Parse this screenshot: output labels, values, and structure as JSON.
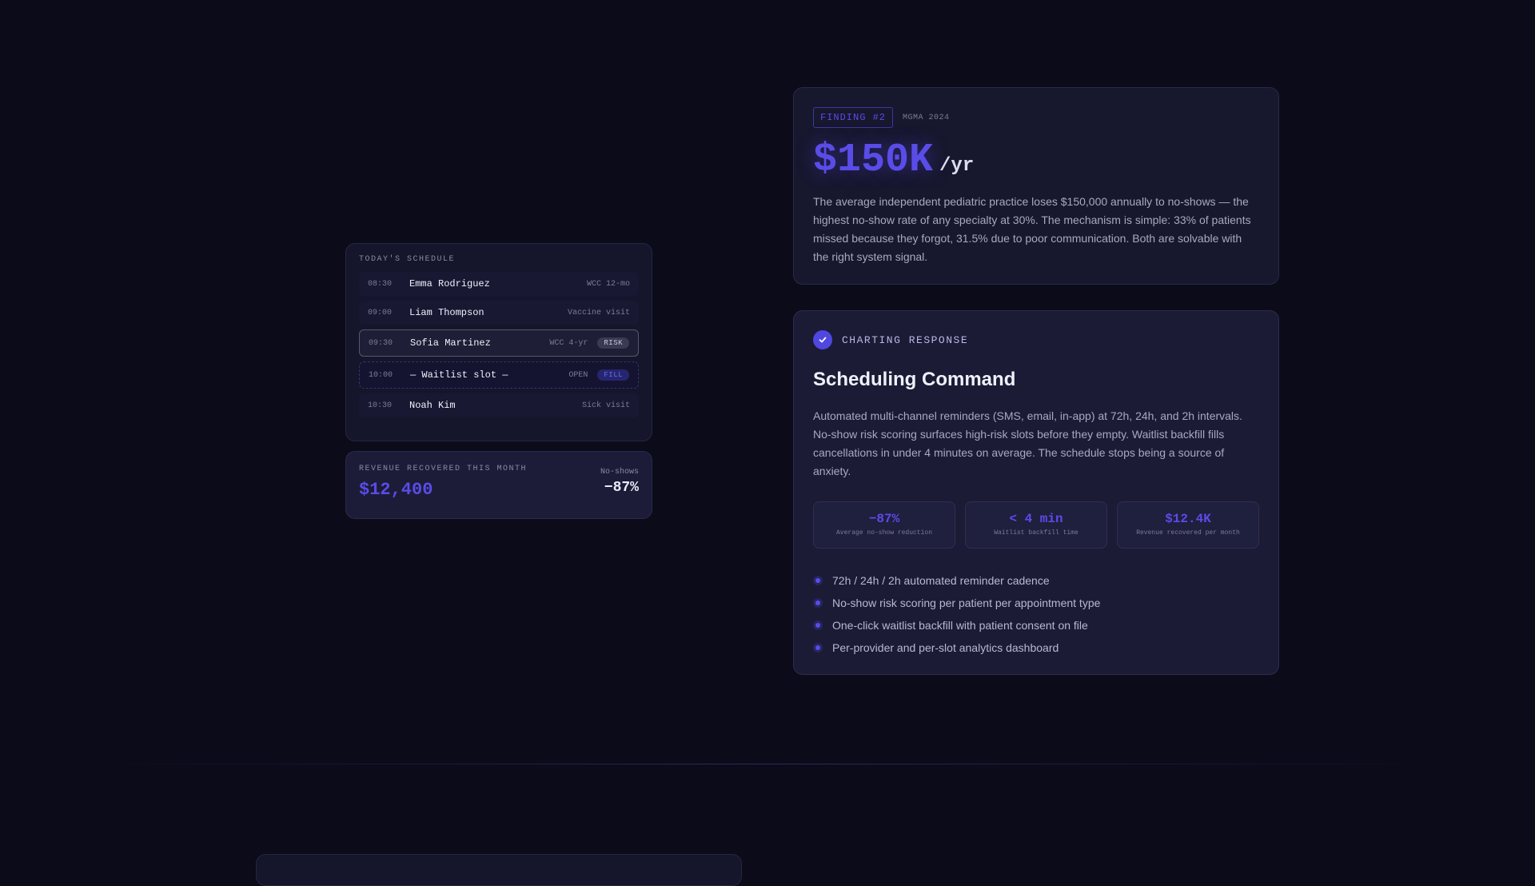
{
  "schedule": {
    "title": "TODAY'S SCHEDULE",
    "rows": [
      {
        "time": "08:30",
        "name": "Emma Rodriguez",
        "type": "WCC 12-mo"
      },
      {
        "time": "09:00",
        "name": "Liam Thompson",
        "type": "Vaccine visit"
      },
      {
        "time": "09:30",
        "name": "Sofia Martinez",
        "type": "WCC 4-yr",
        "badge": "RISK"
      },
      {
        "time": "10:00",
        "name": "— Waitlist slot —",
        "type": "OPEN",
        "badge": "FILL"
      },
      {
        "time": "10:30",
        "name": "Noah Kim",
        "type": "Sick visit"
      }
    ]
  },
  "revenue": {
    "label": "REVENUE RECOVERED THIS MONTH",
    "value": "$12,400",
    "noshow_label": "No-shows",
    "noshow_value": "−87%"
  },
  "finding": {
    "tag": "FINDING #2",
    "source": "MGMA 2024",
    "value": "$150K",
    "unit": "/yr",
    "body": "The average independent pediatric practice loses $150,000 annually to no-shows — the highest no-show rate of any specialty at 30%. The mechanism is simple: 33% of patients missed because they forgot, 31.5% due to poor communication. Both are solvable with the right system signal."
  },
  "charting": {
    "tag": "CHARTING RESPONSE",
    "title": "Scheduling Command",
    "body": "Automated multi-channel reminders (SMS, email, in-app) at 72h, 24h, and 2h intervals. No-show risk scoring surfaces high-risk slots before they empty. Waitlist backfill fills cancellations in under 4 minutes on average. The schedule stops being a source of anxiety.",
    "stats": [
      {
        "value": "−87%",
        "label": "Average no-show reduction"
      },
      {
        "value": "< 4 min",
        "label": "Waitlist backfill time"
      },
      {
        "value": "$12.4K",
        "label": "Revenue recovered per month"
      }
    ],
    "features": [
      "72h / 24h / 2h automated reminder cadence",
      "No-show risk scoring per patient per appointment type",
      "One-click waitlist backfill with patient consent on file",
      "Per-provider and per-slot analytics dashboard"
    ]
  },
  "icons": {
    "check": "check-icon",
    "bullet": "dot-icon"
  },
  "colors": {
    "background": "#0b0b1a",
    "accent": "#5a4ce8",
    "card": "#17172e"
  }
}
